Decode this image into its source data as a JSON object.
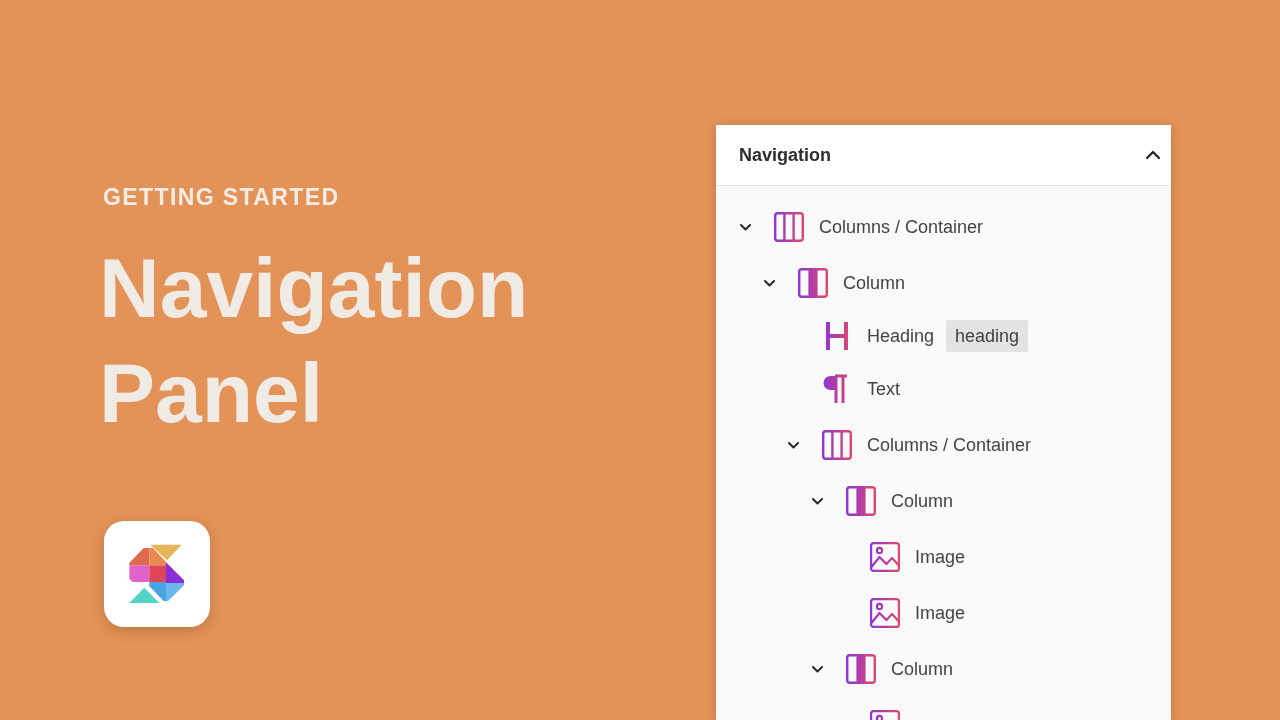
{
  "hero": {
    "eyebrow": "GETTING STARTED",
    "title": "Navigation Panel"
  },
  "panel": {
    "title": "Navigation",
    "expanded": true,
    "tree": [
      {
        "kind": "columns",
        "label": "Columns / Container",
        "expanded": true,
        "children": [
          {
            "kind": "column",
            "label": "Column",
            "expanded": true,
            "children": [
              {
                "kind": "heading",
                "label": "Heading",
                "badge": "heading"
              },
              {
                "kind": "text",
                "label": "Text"
              },
              {
                "kind": "columns",
                "label": "Columns / Container",
                "expanded": true,
                "children": [
                  {
                    "kind": "column",
                    "label": "Column",
                    "expanded": true,
                    "children": [
                      {
                        "kind": "image",
                        "label": "Image"
                      },
                      {
                        "kind": "image",
                        "label": "Image"
                      }
                    ]
                  },
                  {
                    "kind": "column",
                    "label": "Column",
                    "expanded": true,
                    "children": [
                      {
                        "kind": "image"
                      }
                    ]
                  }
                ]
              }
            ]
          }
        ]
      }
    ]
  }
}
